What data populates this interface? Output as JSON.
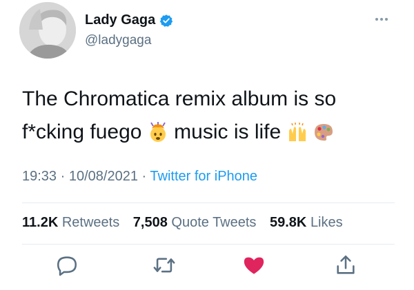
{
  "user": {
    "display_name": "Lady Gaga",
    "handle": "@ladygaga",
    "verified": true,
    "avatar_icon": "profile-photo"
  },
  "tweet": {
    "text_line1": "The Chromatica remix album is so",
    "text_line2_part1": "f*cking fuego",
    "text_line2_part2": "music is life",
    "emojis": [
      "exploding-head-emoji",
      "raising-hands-emoji",
      "artist-palette-emoji"
    ]
  },
  "meta": {
    "time": "19:33",
    "sep1": "·",
    "date": "10/08/2021",
    "sep2": "·",
    "source": "Twitter for iPhone"
  },
  "stats": {
    "retweets_count": "11.2K",
    "retweets_label": "Retweets",
    "quotes_count": "7,508",
    "quotes_label": "Quote Tweets",
    "likes_count": "59.8K",
    "likes_label": "Likes"
  },
  "actions": {
    "reply_icon": "reply-icon",
    "retweet_icon": "retweet-icon",
    "like_icon": "heart-icon",
    "share_icon": "share-icon"
  },
  "colors": {
    "link": "#1d9bf0",
    "secondary_text": "#5b7083",
    "like_red": "#e0245e",
    "divider": "#e6ecf0"
  }
}
